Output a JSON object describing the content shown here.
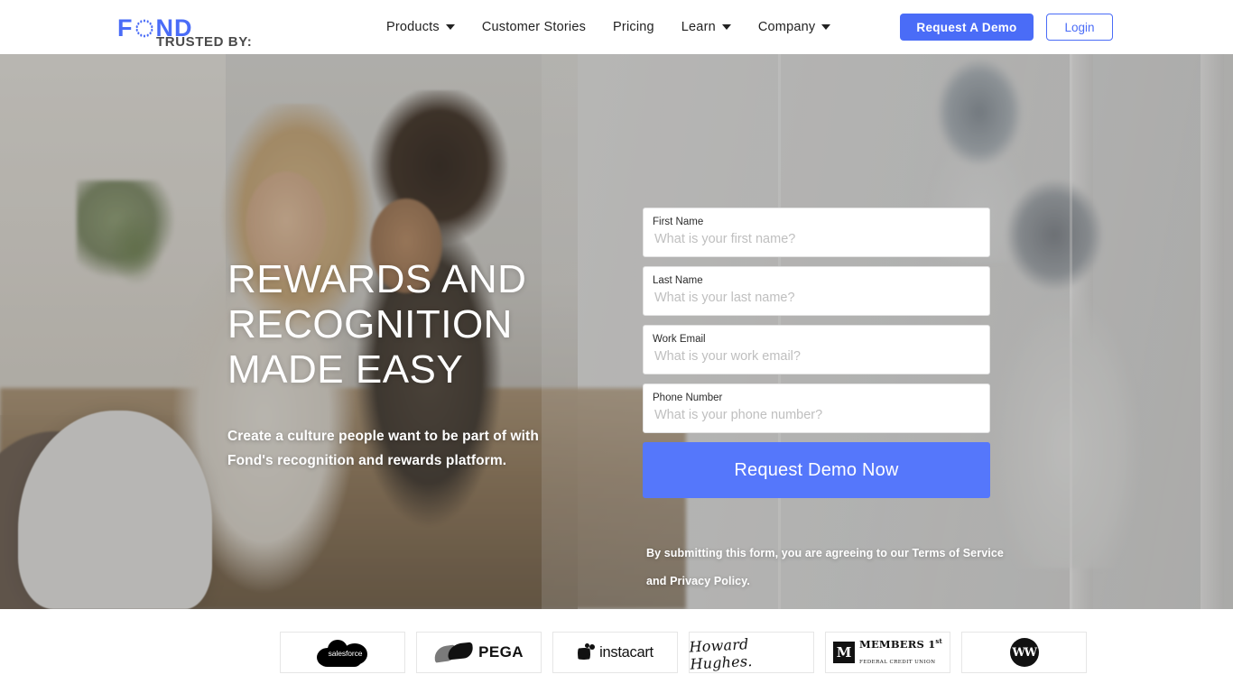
{
  "brand": {
    "logo_text_left": "F",
    "logo_icon": "dotted-circle-o",
    "logo_text_right": "ND",
    "accent_color": "#4a6cf7",
    "button_blue": "#5577fb"
  },
  "nav": {
    "links": [
      {
        "label": "Products",
        "has_caret": true
      },
      {
        "label": "Customer Stories",
        "has_caret": false
      },
      {
        "label": "Pricing",
        "has_caret": false
      },
      {
        "label": "Learn",
        "has_caret": true
      },
      {
        "label": "Company",
        "has_caret": true
      }
    ],
    "demo_button": "Request A Demo",
    "login_button": "Login"
  },
  "hero": {
    "headline_line1": "REWARDS AND",
    "headline_line2": "RECOGNITION",
    "headline_line3": "MADE EASY",
    "subheadline": "Create a culture people want to be part of with Fond's recognition and rewards platform."
  },
  "form": {
    "fields": [
      {
        "label": "First Name",
        "placeholder": "What is your first name?",
        "value": ""
      },
      {
        "label": "Last Name",
        "placeholder": "What is your last name?",
        "value": ""
      },
      {
        "label": "Work Email",
        "placeholder": "What is your work email?",
        "value": ""
      },
      {
        "label": "Phone Number",
        "placeholder": "What is your phone number?",
        "value": ""
      }
    ],
    "submit_label": "Request Demo Now",
    "disclaimer": "By submitting this form, you are agreeing to our Terms of Service and Privacy Policy."
  },
  "trusted": {
    "label": "TRUSTED BY:",
    "logos": [
      {
        "name": "salesforce",
        "wordmark": "salesforce"
      },
      {
        "name": "pega",
        "wordmark": "PEGA"
      },
      {
        "name": "instacart",
        "wordmark": "instacart"
      },
      {
        "name": "howard-hughes",
        "wordmark": "Howard Hughes."
      },
      {
        "name": "members-1st",
        "mark": "M",
        "line1": "MEMBERS 1",
        "sup": "st",
        "line2": "FEDERAL CREDIT UNION"
      },
      {
        "name": "ww",
        "wordmark": "WW"
      }
    ]
  }
}
